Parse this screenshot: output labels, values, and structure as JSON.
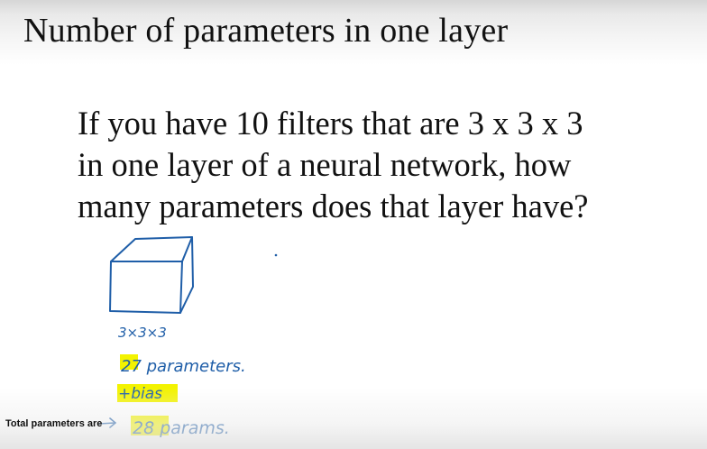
{
  "slide": {
    "title": "Number of parameters in one layer",
    "question_lines": [
      "If you have 10 filters that are 3 x 3 x 3",
      "in one layer of a neural network, how",
      "many parameters does that layer have?"
    ]
  },
  "handwriting": {
    "dims": "3×3×3",
    "params": "27 parameters.",
    "bias": "+bias",
    "total": "28 params."
  },
  "overlay": {
    "label": "Total parameters are"
  },
  "colors": {
    "ink": "#1f5ea8",
    "highlight": "#f3f300"
  }
}
